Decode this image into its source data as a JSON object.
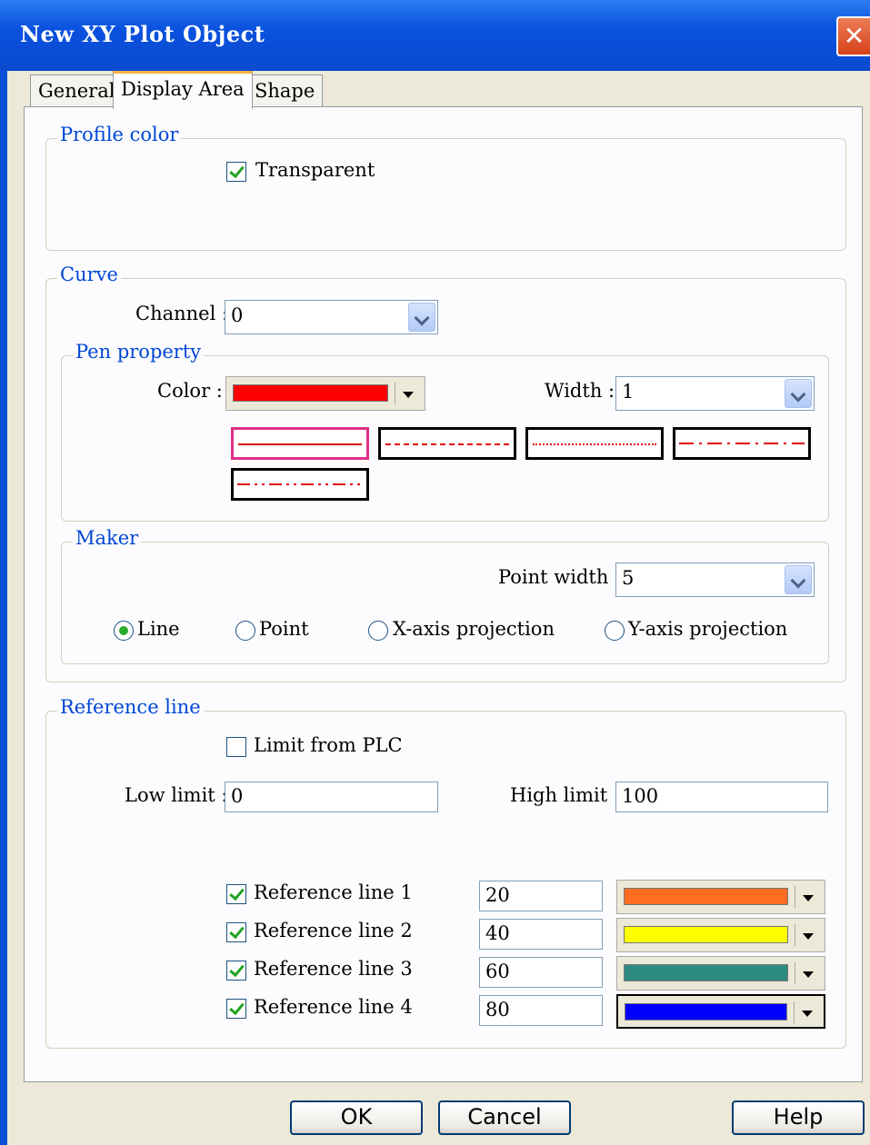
{
  "window": {
    "title": "New  XY Plot Object",
    "close_glyph": "✕"
  },
  "tabs": [
    {
      "label": "General",
      "active": false
    },
    {
      "label": "Display Area",
      "active": true
    },
    {
      "label": "Shape",
      "active": false
    }
  ],
  "profile_color": {
    "title": "Profile color",
    "transparent_label": "Transparent",
    "transparent_checked": true
  },
  "curve": {
    "title": "Curve",
    "channel_label": "Channel :",
    "channel_value": "0",
    "pen": {
      "title": "Pen property",
      "color_label": "Color :",
      "color_value": "#ff0000",
      "width_label": "Width :",
      "width_value": "1",
      "line_styles": [
        "solid",
        "dashed",
        "dotted",
        "dash-dot",
        "dash-dot-dot"
      ],
      "selected_style": "solid"
    },
    "marker": {
      "title": "Maker",
      "point_width_label": "Point width :",
      "point_width_value": "5",
      "options": [
        "Line",
        "Point",
        "X-axis projection",
        "Y-axis projection"
      ],
      "selected": "Line"
    }
  },
  "reference": {
    "title": "Reference line",
    "limit_from_plc_label": "Limit from PLC",
    "limit_from_plc_checked": false,
    "low_label": "Low limit :",
    "low_value": "0",
    "high_label": "High limit :",
    "high_value": "100",
    "lines": [
      {
        "label": "Reference line 1",
        "checked": true,
        "value": "20",
        "color": "#ff6d21"
      },
      {
        "label": "Reference line 2",
        "checked": true,
        "value": "40",
        "color": "#ffff00"
      },
      {
        "label": "Reference line 3",
        "checked": true,
        "value": "60",
        "color": "#2e8b80"
      },
      {
        "label": "Reference line 4",
        "checked": true,
        "value": "80",
        "color": "#0000ff"
      }
    ]
  },
  "buttons": {
    "ok": "OK",
    "cancel": "Cancel",
    "help": "Help"
  }
}
